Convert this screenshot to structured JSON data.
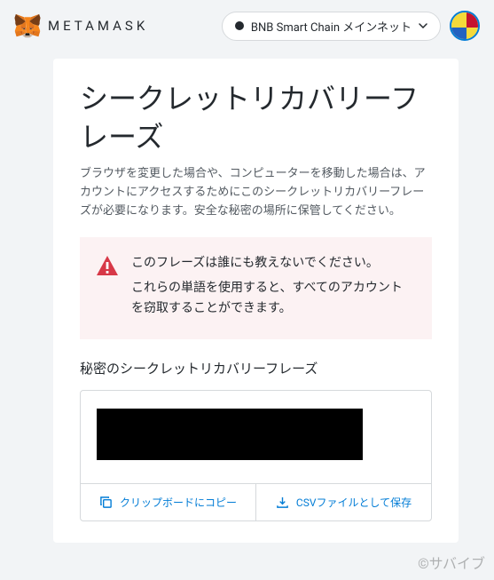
{
  "brand": {
    "name": "METAMASK"
  },
  "network": {
    "label": "BNB Smart Chain メインネット"
  },
  "page": {
    "title": "シークレットリカバリーフレーズ",
    "description": "ブラウザを変更した場合や、コンピューターを移動した場合は、アカウントにアクセスするためにこのシークレットリカバリーフレーズが必要になります。安全な秘密の場所に保管してください。"
  },
  "warning": {
    "line1": "このフレーズは誰にも教えないでください。",
    "line2": "これらの単語を使用すると、すべてのアカウントを窃取することができます。"
  },
  "phrase": {
    "label": "秘密のシークレットリカバリーフレーズ",
    "copy_label": "クリップボードにコピー",
    "save_label": "CSVファイルとして保存"
  },
  "watermark": "©サバイブ"
}
